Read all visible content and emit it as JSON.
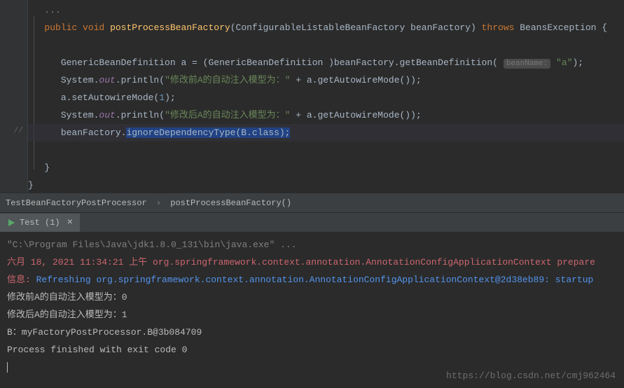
{
  "code": {
    "comment_marker": "//",
    "kw_public": "public",
    "kw_void": "void",
    "method_name": "postProcessBeanFactory",
    "param_type": "ConfigurableListableBeanFactory",
    "param_name": "beanFactory",
    "kw_throws": "throws",
    "exception": "BeansException",
    "line3_a": "GenericBeanDefinition a = ",
    "line3_cast": "GenericBeanDefinition ",
    "line3_b": "beanFactory.getBeanDefinition",
    "hint_label": "beanName:",
    "hint_value": "\"a\"",
    "line4_a": "System.",
    "out": "out",
    "line4_b": ".println",
    "str_before": "\"修改前A的自动注入模型为：\"",
    "str_after": "\"修改后A的自动注入模型为：\"",
    "plus_call": " + a.getAutowireMode",
    "line5": "a.setAutowireMode",
    "line5_arg": "1",
    "line7_a": "beanFactory.",
    "line7_sel": "ignoreDependencyType(B.class);"
  },
  "breadcrumb": {
    "class": "TestBeanFactoryPostProcessor",
    "method": "postProcessBeanFactory()"
  },
  "tab": {
    "label": "Test (1)"
  },
  "console": {
    "line1": "\"C:\\Program Files\\Java\\jdk1.8.0_131\\bin\\java.exe\" ...",
    "line2_a": "六月 18, 2021 11:34:21 上午",
    "line2_b": " org.springframework.context.annotation.AnnotationConfigApplicationContext prepare",
    "line3_a": "信息: ",
    "line3_b": "Refreshing org.springframework.context.annotation.AnnotationConfigApplicationContext@2d38eb89: startup",
    "line4": "修改前A的自动注入模型为：0",
    "line5": "修改后A的自动注入模型为：1",
    "line6": "B：myFactoryPostProcessor.B@3b084709",
    "line7": "",
    "line8": "Process finished with exit code 0"
  },
  "watermark": "https://blog.csdn.net/cmj962464"
}
